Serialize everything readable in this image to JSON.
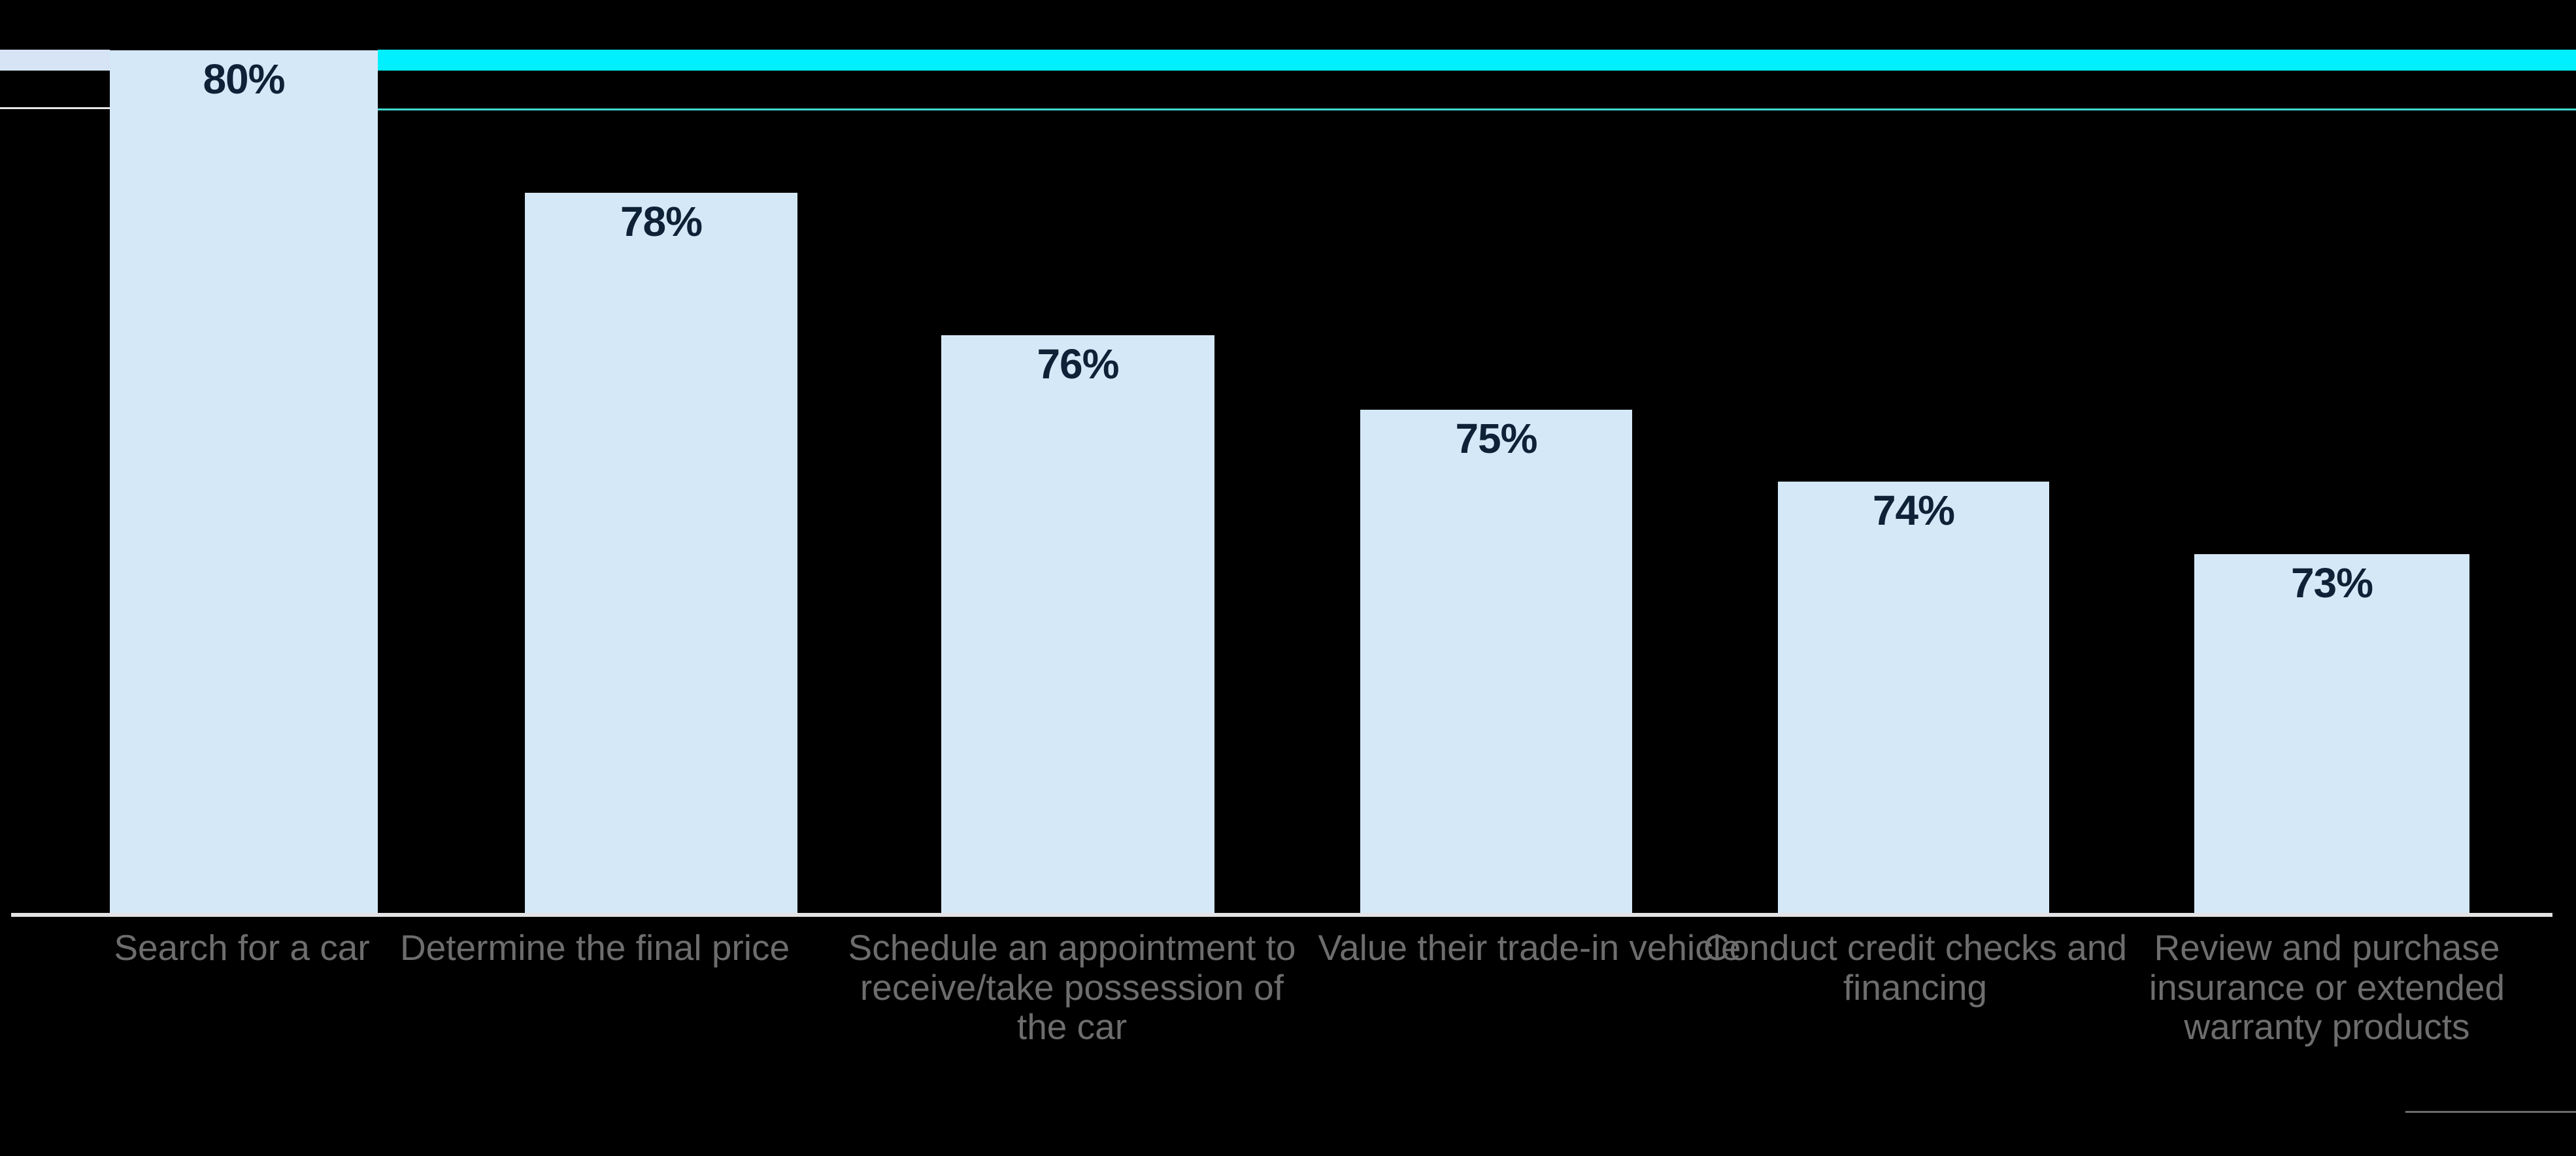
{
  "chart_data": {
    "type": "bar",
    "title": "",
    "subtitle": "",
    "xlabel": "",
    "ylabel": "",
    "ylim": [
      0,
      84
    ],
    "grid": false,
    "legend": "none",
    "categories": [
      "Search for a car",
      "Determine the final price",
      "Schedule an appointment to receive/take possession of the car",
      "Value their trade-in vehicle",
      "Conduct credit checks and financing",
      "Review and purchase insurance or extended warranty products"
    ],
    "values": [
      80,
      78,
      76,
      75,
      74,
      73
    ],
    "data_labels": [
      "80%",
      "78%",
      "76%",
      "75%",
      "74%",
      "73%"
    ],
    "bar_color": "#d5e8f8",
    "data_label_color": "#0d2236",
    "category_label_color": "#6d6d6d",
    "axis_line_color": "#e3e3e5",
    "background_color": "#000000",
    "accent_color": "#00f0ff",
    "accent_line_color": "#3fd9d0",
    "secondary_band_color": "#d6e4f5",
    "geometry": {
      "bar_pixel_lefts": [
        168,
        803,
        1440,
        2081,
        2720,
        3357
      ],
      "bar_pixel_widths": [
        410,
        417,
        418,
        416,
        415,
        421
      ],
      "bar_pixel_tops": [
        77,
        295,
        513,
        627,
        737,
        848
      ],
      "baseline_y": 1399,
      "label_pixel_lefts": [
        60,
        600,
        1290,
        1990,
        2580,
        3230
      ],
      "label_pixel_widths": [
        620,
        620,
        700,
        700,
        700,
        660
      ]
    }
  }
}
